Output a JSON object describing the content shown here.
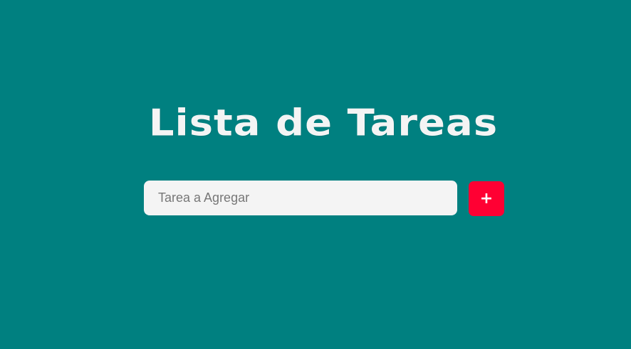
{
  "header": {
    "title": "Lista de Tareas"
  },
  "form": {
    "input": {
      "value": "",
      "placeholder": "Tarea a Agregar"
    },
    "add_button": {
      "label": "+",
      "icon": "plus-icon"
    }
  },
  "colors": {
    "background": "#008080",
    "title": "#f4f4f4",
    "input_background": "#f4f4f4",
    "button_background": "#ff0033",
    "button_text": "#ffffff"
  }
}
